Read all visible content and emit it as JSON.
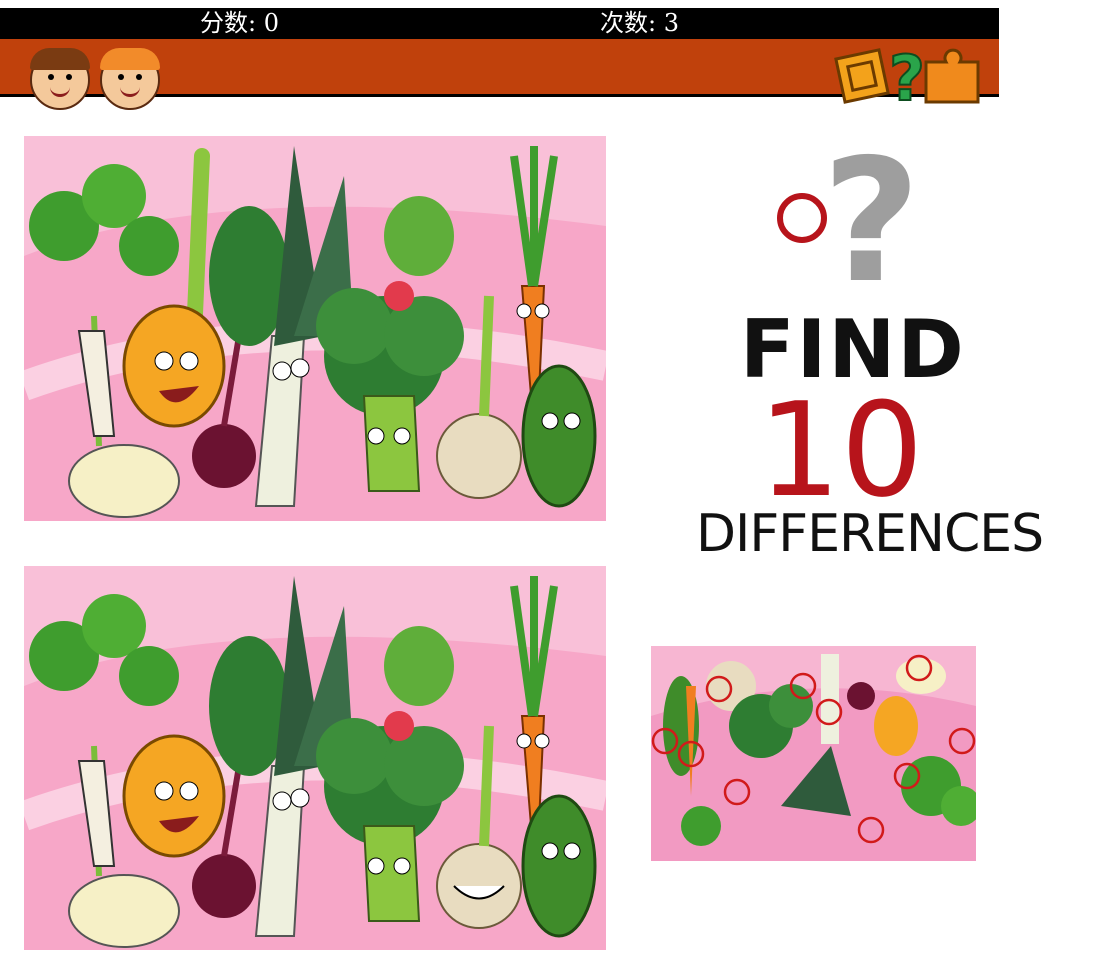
{
  "hud": {
    "score_label": "分数: 0",
    "tries_label": "次数: 3"
  },
  "promo": {
    "find": "FIND",
    "count": "10",
    "differences": "DIFFERENCES"
  },
  "colors": {
    "banner": "#c0410c",
    "panel_bg": "#f7a7c8",
    "circle_red": "#b7141b"
  },
  "icons": [
    "girl-face-icon",
    "boy-face-icon",
    "puzzle-question-icon",
    "question-mark-icon"
  ]
}
